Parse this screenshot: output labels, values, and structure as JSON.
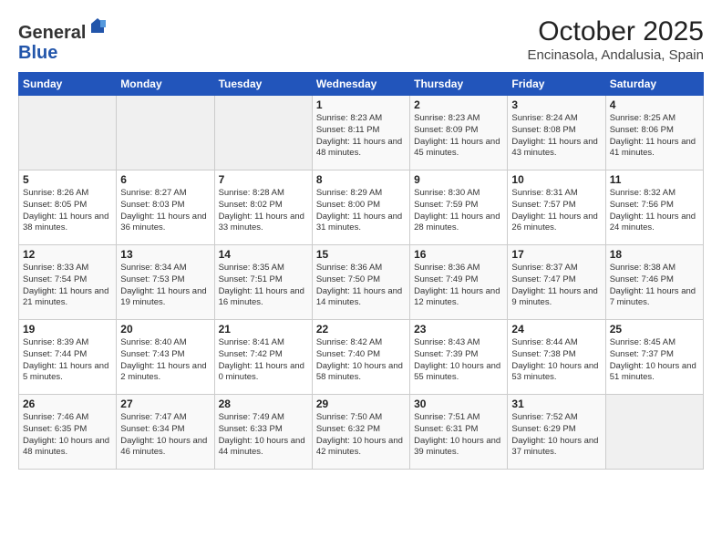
{
  "logo": {
    "general": "General",
    "blue": "Blue"
  },
  "title": "October 2025",
  "subtitle": "Encinasola, Andalusia, Spain",
  "weekdays": [
    "Sunday",
    "Monday",
    "Tuesday",
    "Wednesday",
    "Thursday",
    "Friday",
    "Saturday"
  ],
  "weeks": [
    [
      {
        "day": "",
        "info": ""
      },
      {
        "day": "",
        "info": ""
      },
      {
        "day": "",
        "info": ""
      },
      {
        "day": "1",
        "info": "Sunrise: 8:23 AM\nSunset: 8:11 PM\nDaylight: 11 hours and 48 minutes."
      },
      {
        "day": "2",
        "info": "Sunrise: 8:23 AM\nSunset: 8:09 PM\nDaylight: 11 hours and 45 minutes."
      },
      {
        "day": "3",
        "info": "Sunrise: 8:24 AM\nSunset: 8:08 PM\nDaylight: 11 hours and 43 minutes."
      },
      {
        "day": "4",
        "info": "Sunrise: 8:25 AM\nSunset: 8:06 PM\nDaylight: 11 hours and 41 minutes."
      }
    ],
    [
      {
        "day": "5",
        "info": "Sunrise: 8:26 AM\nSunset: 8:05 PM\nDaylight: 11 hours and 38 minutes."
      },
      {
        "day": "6",
        "info": "Sunrise: 8:27 AM\nSunset: 8:03 PM\nDaylight: 11 hours and 36 minutes."
      },
      {
        "day": "7",
        "info": "Sunrise: 8:28 AM\nSunset: 8:02 PM\nDaylight: 11 hours and 33 minutes."
      },
      {
        "day": "8",
        "info": "Sunrise: 8:29 AM\nSunset: 8:00 PM\nDaylight: 11 hours and 31 minutes."
      },
      {
        "day": "9",
        "info": "Sunrise: 8:30 AM\nSunset: 7:59 PM\nDaylight: 11 hours and 28 minutes."
      },
      {
        "day": "10",
        "info": "Sunrise: 8:31 AM\nSunset: 7:57 PM\nDaylight: 11 hours and 26 minutes."
      },
      {
        "day": "11",
        "info": "Sunrise: 8:32 AM\nSunset: 7:56 PM\nDaylight: 11 hours and 24 minutes."
      }
    ],
    [
      {
        "day": "12",
        "info": "Sunrise: 8:33 AM\nSunset: 7:54 PM\nDaylight: 11 hours and 21 minutes."
      },
      {
        "day": "13",
        "info": "Sunrise: 8:34 AM\nSunset: 7:53 PM\nDaylight: 11 hours and 19 minutes."
      },
      {
        "day": "14",
        "info": "Sunrise: 8:35 AM\nSunset: 7:51 PM\nDaylight: 11 hours and 16 minutes."
      },
      {
        "day": "15",
        "info": "Sunrise: 8:36 AM\nSunset: 7:50 PM\nDaylight: 11 hours and 14 minutes."
      },
      {
        "day": "16",
        "info": "Sunrise: 8:36 AM\nSunset: 7:49 PM\nDaylight: 11 hours and 12 minutes."
      },
      {
        "day": "17",
        "info": "Sunrise: 8:37 AM\nSunset: 7:47 PM\nDaylight: 11 hours and 9 minutes."
      },
      {
        "day": "18",
        "info": "Sunrise: 8:38 AM\nSunset: 7:46 PM\nDaylight: 11 hours and 7 minutes."
      }
    ],
    [
      {
        "day": "19",
        "info": "Sunrise: 8:39 AM\nSunset: 7:44 PM\nDaylight: 11 hours and 5 minutes."
      },
      {
        "day": "20",
        "info": "Sunrise: 8:40 AM\nSunset: 7:43 PM\nDaylight: 11 hours and 2 minutes."
      },
      {
        "day": "21",
        "info": "Sunrise: 8:41 AM\nSunset: 7:42 PM\nDaylight: 11 hours and 0 minutes."
      },
      {
        "day": "22",
        "info": "Sunrise: 8:42 AM\nSunset: 7:40 PM\nDaylight: 10 hours and 58 minutes."
      },
      {
        "day": "23",
        "info": "Sunrise: 8:43 AM\nSunset: 7:39 PM\nDaylight: 10 hours and 55 minutes."
      },
      {
        "day": "24",
        "info": "Sunrise: 8:44 AM\nSunset: 7:38 PM\nDaylight: 10 hours and 53 minutes."
      },
      {
        "day": "25",
        "info": "Sunrise: 8:45 AM\nSunset: 7:37 PM\nDaylight: 10 hours and 51 minutes."
      }
    ],
    [
      {
        "day": "26",
        "info": "Sunrise: 7:46 AM\nSunset: 6:35 PM\nDaylight: 10 hours and 48 minutes."
      },
      {
        "day": "27",
        "info": "Sunrise: 7:47 AM\nSunset: 6:34 PM\nDaylight: 10 hours and 46 minutes."
      },
      {
        "day": "28",
        "info": "Sunrise: 7:49 AM\nSunset: 6:33 PM\nDaylight: 10 hours and 44 minutes."
      },
      {
        "day": "29",
        "info": "Sunrise: 7:50 AM\nSunset: 6:32 PM\nDaylight: 10 hours and 42 minutes."
      },
      {
        "day": "30",
        "info": "Sunrise: 7:51 AM\nSunset: 6:31 PM\nDaylight: 10 hours and 39 minutes."
      },
      {
        "day": "31",
        "info": "Sunrise: 7:52 AM\nSunset: 6:29 PM\nDaylight: 10 hours and 37 minutes."
      },
      {
        "day": "",
        "info": ""
      }
    ]
  ]
}
